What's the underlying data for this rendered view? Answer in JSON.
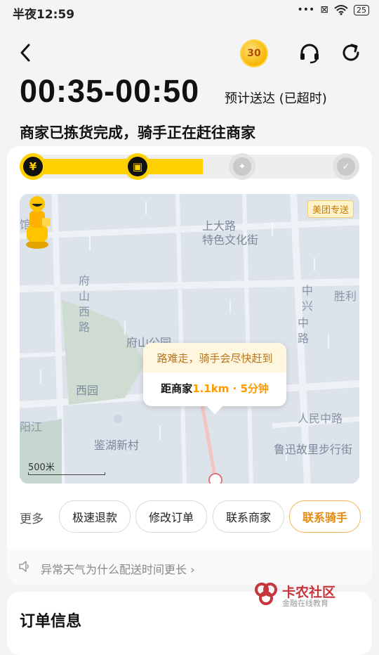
{
  "status_bar": {
    "time": "半夜12:59",
    "signal": "•••",
    "sim": "⊠",
    "battery": "25"
  },
  "header": {
    "coin_value": "30"
  },
  "eta": {
    "time_range": "00:35-00:50",
    "label": "预计送达 (已超时)"
  },
  "order_status": "商家已拣货完成，骑手正在赶往商家",
  "progress": {
    "fraction": 0.54,
    "steps": [
      "¥",
      "▣",
      "✦",
      "✓"
    ]
  },
  "map": {
    "brand_badge": "美团专送",
    "places": [
      "上大路",
      "特色文化街",
      "府",
      "山",
      "西",
      "路",
      "府山公园",
      "中",
      "兴",
      "中",
      "路",
      "胜利",
      "西园",
      "人民中路",
      "鉴湖新村",
      "鲁迅故里步行街",
      "馆",
      "阳江"
    ],
    "bubble": {
      "notice": "路难走，骑手会尽快赶到",
      "distance_prefix": "距商家",
      "distance_value": "1.1km · 5分钟"
    },
    "scale": "500米"
  },
  "actions": {
    "more_label": "更多",
    "buttons": [
      "极速退款",
      "修改订单",
      "联系商家",
      "联系骑手"
    ]
  },
  "weather_notice": "异常天气为什么配送时间更长 ›",
  "order_info_title": "订单信息",
  "watermark": {
    "title": "卡农社区",
    "subtitle": "金融在线教育"
  }
}
